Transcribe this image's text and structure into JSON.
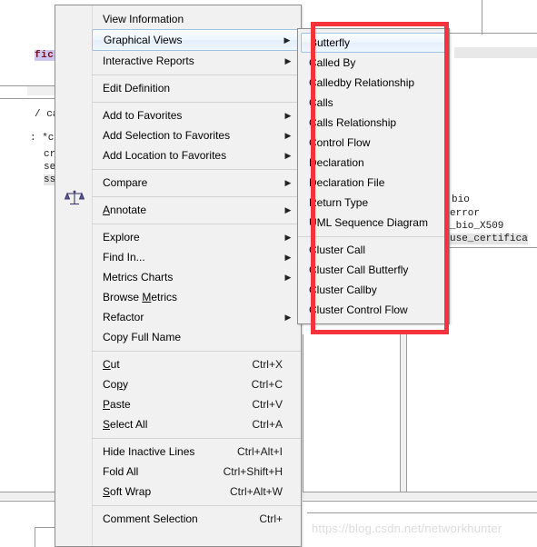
{
  "background": {
    "code_lines": [
      {
        "text": "fica",
        "kind": "highlight"
      },
      {
        "text": "/ calls",
        "kind": "plain"
      },
      {
        "text": ": *ctx,",
        "kind": "plain"
      },
      {
        "text": "crea",
        "kind": "plain"
      },
      {
        "text": "set_",
        "kind": "plain"
      },
      {
        "text": "sslC",
        "kind": "plain"
      }
    ],
    "right_code_lines": [
      {
        "text": "bio",
        "kind": "plain"
      },
      {
        "text": "error",
        "kind": "plain"
      },
      {
        "text": "_bio_X509",
        "kind": "plain"
      },
      {
        "text": "use_certifica",
        "kind": "selected"
      }
    ]
  },
  "context_menu": {
    "name": "Graphical Views context menu",
    "groups": [
      {
        "items": [
          {
            "label": "View Information",
            "accel": "",
            "submenu": false,
            "selected": false
          },
          {
            "label": "Graphical Views",
            "accel": "",
            "submenu": true,
            "selected": true
          },
          {
            "label": "Interactive Reports",
            "accel": "",
            "submenu": true,
            "selected": false
          }
        ]
      },
      {
        "items": [
          {
            "label": "Edit Definition",
            "accel": "",
            "submenu": false,
            "selected": false
          }
        ]
      },
      {
        "items": [
          {
            "label": "Add to Favorites",
            "accel": "",
            "submenu": true,
            "selected": false
          },
          {
            "label": "Add Selection to Favorites",
            "accel": "",
            "submenu": true,
            "selected": false
          },
          {
            "label": "Add Location to Favorites",
            "accel": "",
            "submenu": true,
            "selected": false
          }
        ]
      },
      {
        "items": [
          {
            "label": "Compare",
            "accel": "",
            "submenu": true,
            "selected": false
          }
        ]
      },
      {
        "items": [
          {
            "label": "Annotate",
            "accel": "",
            "submenu": true,
            "selected": false,
            "mnemonic": "A"
          }
        ]
      },
      {
        "items": [
          {
            "label": "Explore",
            "accel": "",
            "submenu": true,
            "selected": false
          },
          {
            "label": "Find In...",
            "accel": "",
            "submenu": true,
            "selected": false
          },
          {
            "label": "Metrics Charts",
            "accel": "",
            "submenu": true,
            "selected": false
          },
          {
            "label": "Browse Metrics",
            "accel": "",
            "submenu": false,
            "selected": false,
            "mnemonic": "M"
          },
          {
            "label": "Refactor",
            "accel": "",
            "submenu": true,
            "selected": false
          },
          {
            "label": "Copy Full Name",
            "accel": "",
            "submenu": false,
            "selected": false
          }
        ]
      },
      {
        "items": [
          {
            "label": "Cut",
            "accel": "Ctrl+X",
            "submenu": false,
            "selected": false,
            "mnemonic": "C"
          },
          {
            "label": "Copy",
            "accel": "Ctrl+C",
            "submenu": false,
            "selected": false,
            "mnemonic": "p"
          },
          {
            "label": "Paste",
            "accel": "Ctrl+V",
            "submenu": false,
            "selected": false,
            "mnemonic": "P"
          },
          {
            "label": "Select All",
            "accel": "Ctrl+A",
            "submenu": false,
            "selected": false,
            "mnemonic": "S"
          }
        ]
      },
      {
        "items": [
          {
            "label": "Hide Inactive Lines",
            "accel": "Ctrl+Alt+I",
            "submenu": false,
            "selected": false
          },
          {
            "label": "Fold All",
            "accel": "Ctrl+Shift+H",
            "submenu": false,
            "selected": false
          },
          {
            "label": "Soft Wrap",
            "accel": "Ctrl+Alt+W",
            "submenu": false,
            "selected": false,
            "mnemonic": "S"
          }
        ]
      },
      {
        "items": [
          {
            "label": "Comment Selection",
            "accel": "Ctrl+",
            "submenu": false,
            "selected": false
          }
        ]
      }
    ]
  },
  "submenu": {
    "name": "Graphical Views submenu",
    "groups": [
      {
        "items": [
          {
            "label": "Butterfly",
            "selected": true
          },
          {
            "label": "Called By",
            "selected": false
          },
          {
            "label": "Calledby Relationship",
            "selected": false
          },
          {
            "label": "Calls",
            "selected": false
          },
          {
            "label": "Calls Relationship",
            "selected": false
          },
          {
            "label": "Control Flow",
            "selected": false
          },
          {
            "label": "Declaration",
            "selected": false
          },
          {
            "label": "Declaration File",
            "selected": false
          },
          {
            "label": "Return Type",
            "selected": false
          },
          {
            "label": "UML Sequence Diagram",
            "selected": false
          }
        ]
      },
      {
        "items": [
          {
            "label": "Cluster Call",
            "selected": false
          },
          {
            "label": "Cluster Call Butterfly",
            "selected": false
          },
          {
            "label": "Cluster Callby",
            "selected": false
          },
          {
            "label": "Cluster Control Flow",
            "selected": false
          }
        ]
      }
    ]
  },
  "annotation": {
    "shape": "rectangle",
    "color": "#f5333a",
    "target": "Graphical Views submenu"
  },
  "watermark": {
    "text": "https://blog.csdn.net/networkhunter"
  },
  "icons": {
    "submenu_arrow": "▶",
    "scales": "scales-icon"
  },
  "colors": {
    "menu_background": "#f1f1f1",
    "menu_border": "#8d8d8d",
    "selection_border": "#9cc2e8",
    "annotation_red": "#f5333a",
    "code_highlight_bg": "#ccc7f0",
    "code_highlight_fg": "#7a1020"
  }
}
